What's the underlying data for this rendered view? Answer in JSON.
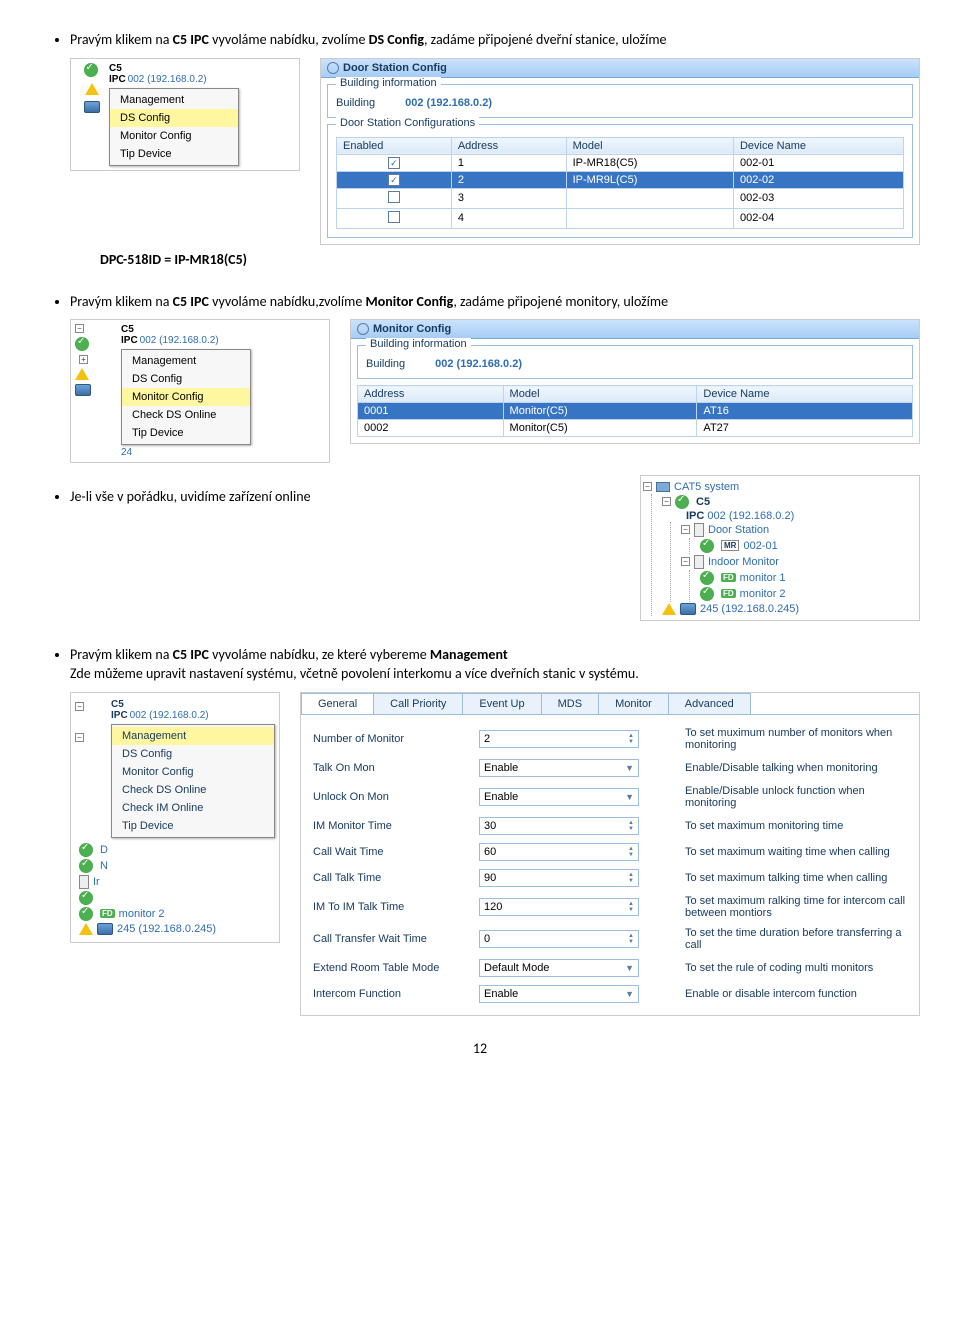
{
  "bullet1_pre": "Pravým klikem na ",
  "bullet1_b1": "C5 IPC",
  "bullet1_mid": " vyvoláme nabídku, zvolíme ",
  "bullet1_b2": "DS Config",
  "bullet1_post": ", zadáme připojené dveřní stanice, uložíme",
  "dpc_line": "DPC-518ID  =  IP-MR18(C5)",
  "menu1": {
    "ip": "002 (192.168.0.2)",
    "items": [
      "Management",
      "DS Config",
      "Monitor Config",
      "Tip Device"
    ],
    "highlight": "DS Config"
  },
  "ds_config": {
    "title": "Door Station Config",
    "fieldset1": "Building information",
    "building_lbl": "Building",
    "building_val": "002 (192.168.0.2)",
    "fieldset2": "Door Station Configurations",
    "cols": [
      "Enabled",
      "Address",
      "Model",
      "Device Name"
    ],
    "rows": [
      {
        "enabled": true,
        "addr": "1",
        "model": "IP-MR18(C5)",
        "name": "002-01",
        "sel": false
      },
      {
        "enabled": true,
        "addr": "2",
        "model": "IP-MR9L(C5)",
        "name": "002-02",
        "sel": true
      },
      {
        "enabled": false,
        "addr": "3",
        "model": "",
        "name": "002-03",
        "sel": false
      },
      {
        "enabled": false,
        "addr": "4",
        "model": "",
        "name": "002-04",
        "sel": false
      }
    ]
  },
  "bullet2_pre": "Pravým klikem na ",
  "bullet2_b1": "C5 IPC",
  "bullet2_mid": " vyvoláme nabídku,zvolíme ",
  "bullet2_b2": "Monitor Config",
  "bullet2_post": ", zadáme připojené monitory, uložíme",
  "menu2": {
    "ip": "002 (192.168.0.2)",
    "extra": "24",
    "items": [
      "Management",
      "DS Config",
      "Monitor Config",
      "Check DS Online",
      "Tip Device"
    ],
    "highlight": "Monitor Config"
  },
  "mon_config": {
    "title": "Monitor Config",
    "fieldset1": "Building information",
    "building_lbl": "Building",
    "building_val": "002 (192.168.0.2)",
    "cols": [
      "Address",
      "Model",
      "Device Name"
    ],
    "rows": [
      {
        "addr": "0001",
        "model": "Monitor(C5)",
        "name": "AT16",
        "sel": true
      },
      {
        "addr": "0002",
        "model": "Monitor(C5)",
        "name": "AT27",
        "sel": false
      }
    ]
  },
  "bullet3": "Je-li vše v pořádku, uvidíme zařízení online",
  "tree": {
    "root": "CAT5 system",
    "ipc": "002 (192.168.0.2)",
    "door_station": "Door Station",
    "mr": "MR",
    "mr_id": "002-01",
    "indoor": "Indoor Monitor",
    "mon1": "monitor 1",
    "mon2": "monitor 2",
    "bottom": "245 (192.168.0.245)"
  },
  "bullet4_pre": "Pravým klikem na ",
  "bullet4_b1": "C5 IPC",
  "bullet4_mid": " vyvoláme nabídku, ze které vybereme ",
  "bullet4_b2": "Management",
  "bullet4_line2": "Zde můžeme upravit nastavení systému, včetně povolení interkomu a více dveřních stanic v systému.",
  "menu3": {
    "ip": "002 (192.168.0.2)",
    "items": [
      "Management",
      "DS Config",
      "Monitor Config",
      "Check DS Online",
      "Check IM Online",
      "Tip Device"
    ],
    "highlight": "Management",
    "left_items": [
      "D",
      "N",
      "Ir",
      "monitor 2"
    ],
    "bottom": "245 (192.168.0.245)"
  },
  "mgmt": {
    "tabs": [
      "General",
      "Call Priority",
      "Event Up",
      "MDS",
      "Monitor",
      "Advanced"
    ],
    "active": "General",
    "rows": [
      {
        "lbl": "Number of Monitor",
        "val": "2",
        "type": "spin",
        "hint": "To set muximum number of monitors when monitoring"
      },
      {
        "lbl": "Talk On Mon",
        "val": "Enable",
        "type": "drop",
        "hint": "Enable/Disable talking when monitoring"
      },
      {
        "lbl": "Unlock On Mon",
        "val": "Enable",
        "type": "drop",
        "hint": "Enable/Disable unlock function when monitoring"
      },
      {
        "lbl": "IM Monitor Time",
        "val": "30",
        "type": "spin",
        "hint": "To set maximum monitoring time"
      },
      {
        "lbl": "Call Wait Time",
        "val": "60",
        "type": "spin",
        "hint": "To set maximum waiting time when calling"
      },
      {
        "lbl": "Call Talk Time",
        "val": "90",
        "type": "spin",
        "hint": "To set maximum talking time when calling"
      },
      {
        "lbl": "IM To IM Talk Time",
        "val": "120",
        "type": "spin",
        "hint": "To set maximum ralking time for intercom call between montiors"
      },
      {
        "lbl": "Call Transfer Wait Time",
        "val": "0",
        "type": "spin",
        "hint": "To set the time duration before transferring a call"
      },
      {
        "lbl": "Extend Room Table Mode",
        "val": "Default Mode",
        "type": "drop",
        "hint": "To set the rule of coding multi monitors"
      },
      {
        "lbl": "Intercom Function",
        "val": "Enable",
        "type": "drop",
        "hint": "Enable or disable intercom function"
      }
    ]
  },
  "page_num": "12"
}
